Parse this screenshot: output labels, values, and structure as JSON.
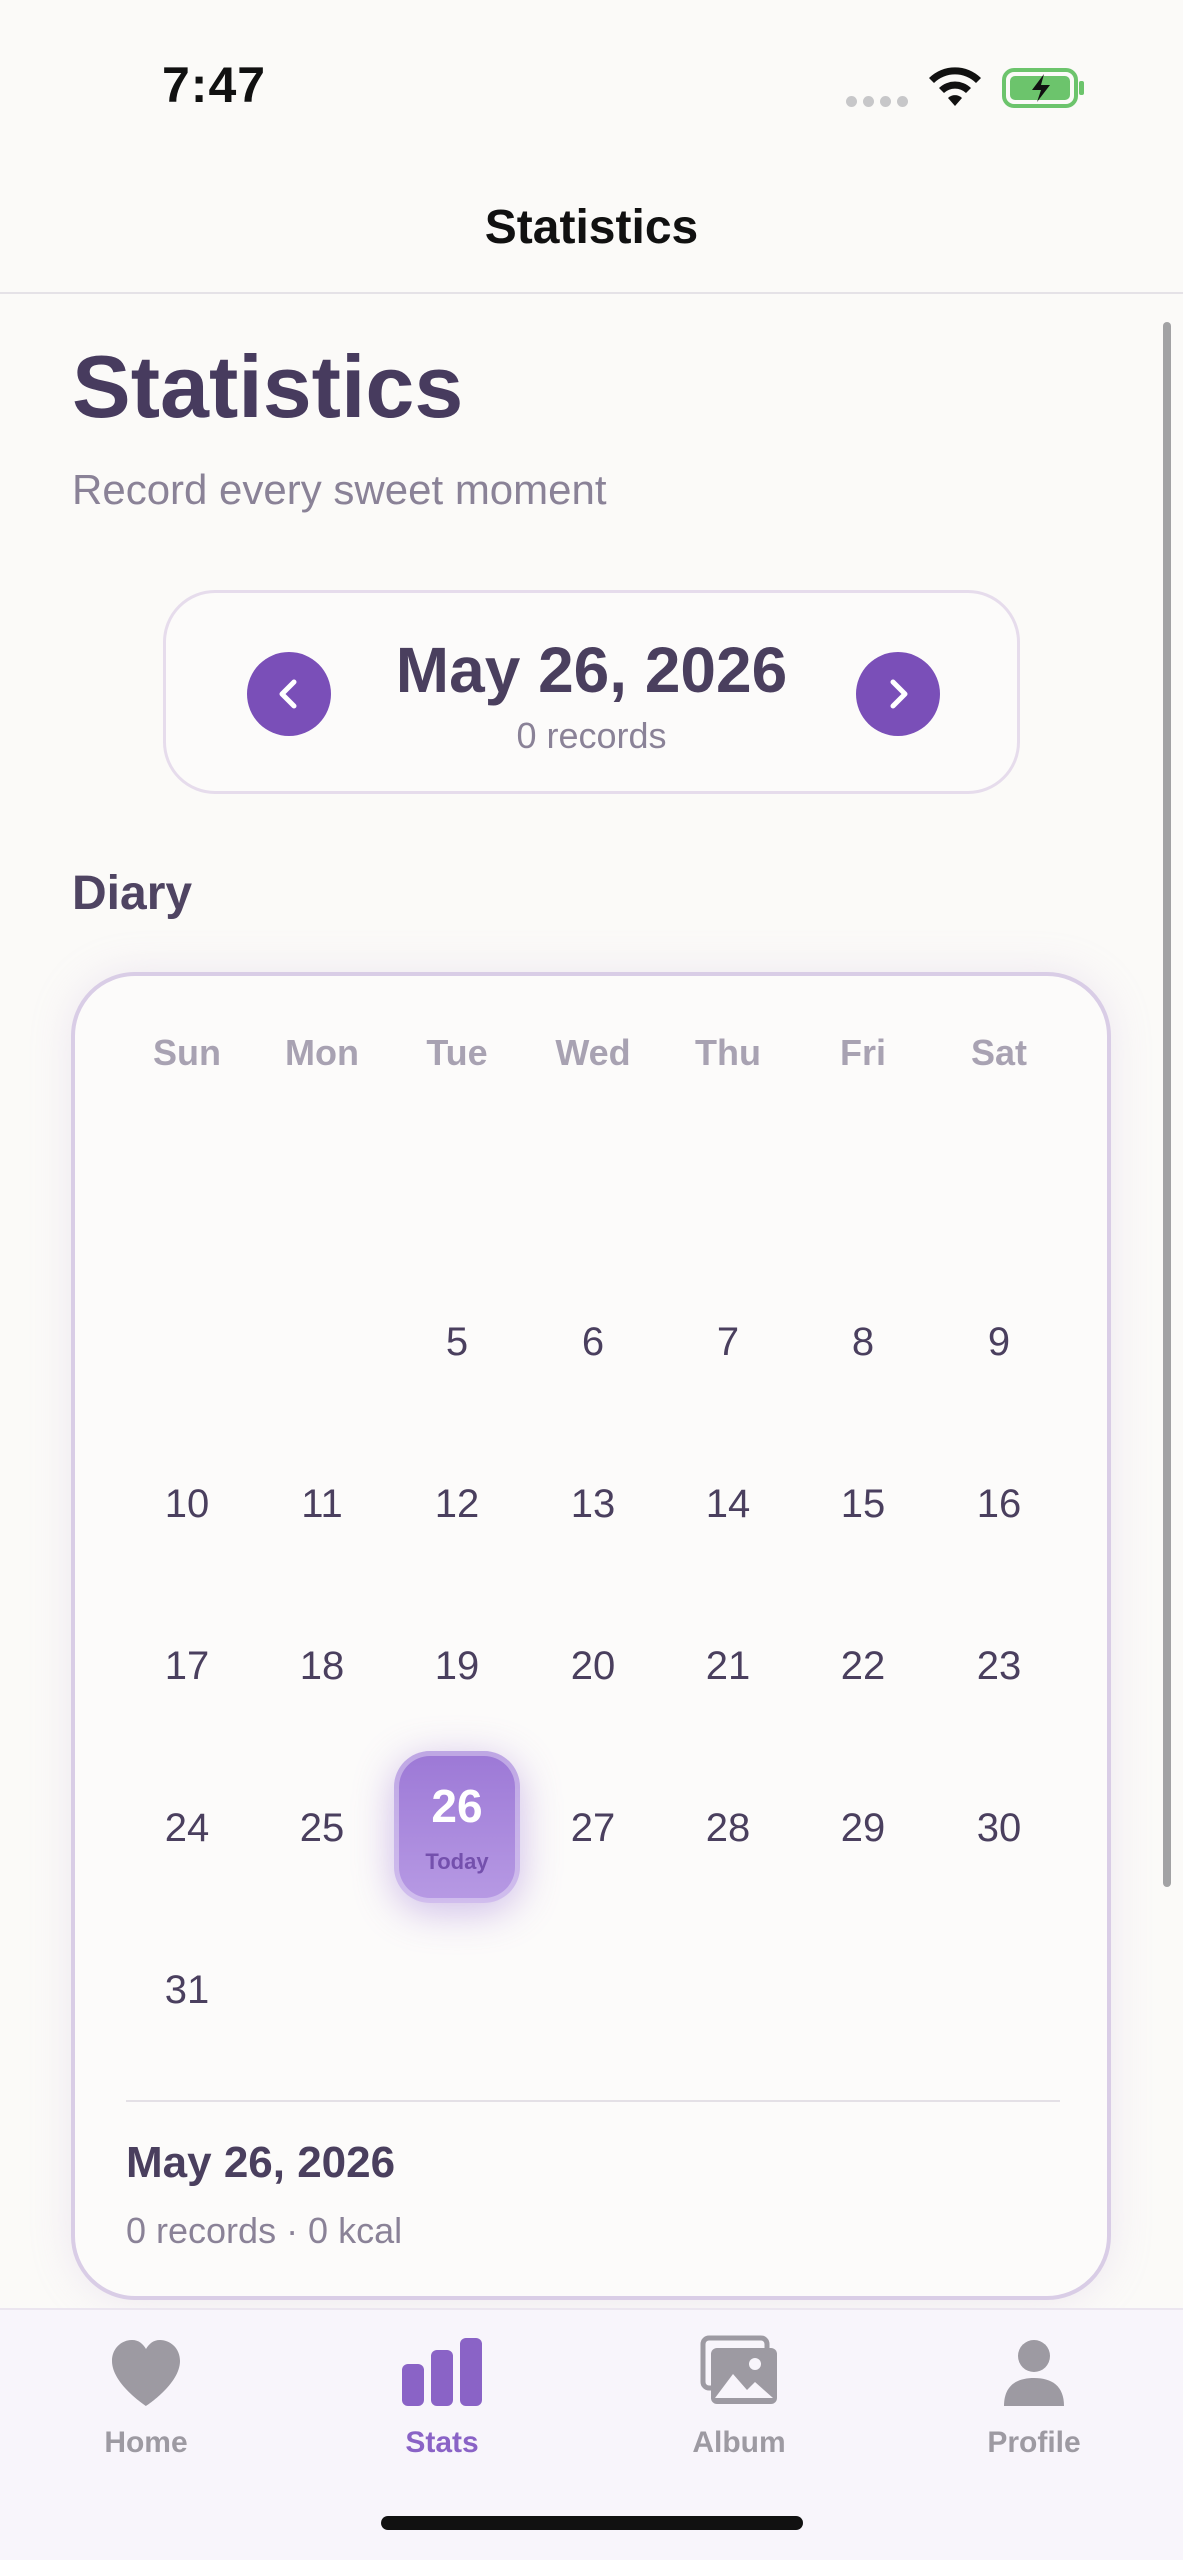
{
  "status_bar": {
    "time": "7:47",
    "icons": [
      "signal-dots-icon",
      "wifi-icon",
      "battery-charging-icon"
    ]
  },
  "nav": {
    "title": "Statistics"
  },
  "header": {
    "title": "Statistics",
    "subtitle": "Record every sweet moment"
  },
  "date_picker": {
    "date": "May 26, 2026",
    "records": "0 records",
    "prev_icon": "chevron-left-icon",
    "next_icon": "chevron-right-icon"
  },
  "diary": {
    "title": "Diary",
    "weekdays": [
      "Sun",
      "Mon",
      "Tue",
      "Wed",
      "Thu",
      "Fri",
      "Sat"
    ],
    "days": {
      "d5": "5",
      "d6": "6",
      "d7": "7",
      "d8": "8",
      "d9": "9",
      "d10": "10",
      "d11": "11",
      "d12": "12",
      "d13": "13",
      "d14": "14",
      "d15": "15",
      "d16": "16",
      "d17": "17",
      "d18": "18",
      "d19": "19",
      "d20": "20",
      "d21": "21",
      "d22": "22",
      "d23": "23",
      "d24": "24",
      "d25": "25",
      "d26": "26",
      "d27": "27",
      "d28": "28",
      "d29": "29",
      "d30": "30",
      "d31": "31"
    },
    "today_label": "Today",
    "summary": {
      "date": "May 26, 2026",
      "stats": "0 records · 0 kcal"
    }
  },
  "tab_bar": {
    "home": "Home",
    "stats": "Stats",
    "album": "Album",
    "profile": "Profile",
    "active": "Stats"
  },
  "colors": {
    "accent": "#7a4fb8",
    "accent_light": "#b79ae4",
    "text_primary": "#4a3f5e",
    "text_secondary": "#8a8297",
    "background": "#fbfaf8"
  }
}
